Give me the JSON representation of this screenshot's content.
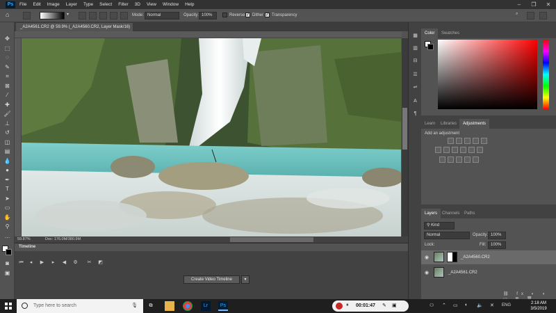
{
  "menubar": {
    "logo": "Ps",
    "items": [
      "File",
      "Edit",
      "Image",
      "Layer",
      "Type",
      "Select",
      "Filter",
      "3D",
      "View",
      "Window",
      "Help"
    ]
  },
  "options": {
    "mode_label": "Mode:",
    "mode_value": "Normal",
    "opacity_label": "Opacity:",
    "opacity_value": "100%",
    "reverse_label": "Reverse",
    "dither_label": "Dither",
    "transparency_label": "Transparency"
  },
  "document": {
    "tab_title": "_A2A4561.CR2 @ 59.9% (_A2A4560.CR2, Layer Mask/16) *",
    "zoom": "59.87%",
    "doc_info": "Doc: 176.0M/380.9M"
  },
  "timeline": {
    "title": "Timeline",
    "create_button": "Create Video Timeline"
  },
  "color_panel": {
    "tabs": [
      "Color",
      "Swatches"
    ]
  },
  "adjust_panel": {
    "tabs": [
      "Learn",
      "Libraries",
      "Adjustments"
    ],
    "add_label": "Add an adjustment"
  },
  "layers_panel": {
    "tabs": [
      "Layers",
      "Channels",
      "Paths"
    ],
    "kind_label": "Kind",
    "blend_mode": "Normal",
    "opacity_label": "Opacity:",
    "opacity_value": "100%",
    "lock_label": "Lock:",
    "fill_label": "Fill:",
    "fill_value": "100%",
    "layers": [
      {
        "name": "_A2A4560.CR2"
      },
      {
        "name": "_A2A4561.CR2"
      }
    ]
  },
  "taskbar": {
    "search_placeholder": "Type here to search",
    "record_time": "00:01:47",
    "language": "ENG",
    "time": "2:18 AM",
    "date": "3/5/2019"
  }
}
